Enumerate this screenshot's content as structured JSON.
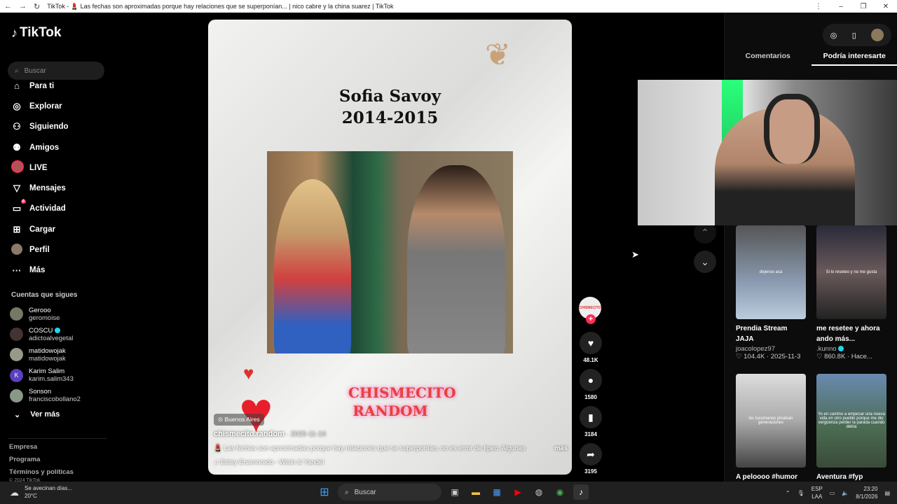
{
  "browser": {
    "title": "TikTok - 💄 Las fechas son aproximadas porque hay relaciones que se superponían... | nico cabre y la china suarez | TikTok"
  },
  "sidebar": {
    "brand": "TikTok",
    "search_placeholder": "Buscar",
    "nav": [
      {
        "label": "Para ti",
        "icon": "home-icon"
      },
      {
        "label": "Explorar",
        "icon": "compass-icon"
      },
      {
        "label": "Siguiendo",
        "icon": "following-icon"
      },
      {
        "label": "Amigos",
        "icon": "friends-icon"
      },
      {
        "label": "LIVE",
        "icon": "live-icon"
      },
      {
        "label": "Mensajes",
        "icon": "messages-icon"
      },
      {
        "label": "Actividad",
        "icon": "activity-icon",
        "badge": "8"
      },
      {
        "label": "Cargar",
        "icon": "upload-icon"
      },
      {
        "label": "Perfil",
        "icon": "profile-icon"
      },
      {
        "label": "Más",
        "icon": "more-icon"
      }
    ],
    "following_title": "Cuentas que sigues",
    "following": [
      {
        "name": "Geroоо",
        "user": "geromoise"
      },
      {
        "name": "COSCU",
        "user": "adictoalvegetal",
        "verified": true
      },
      {
        "name": "matidowojak",
        "user": "matidowojak"
      },
      {
        "name": "Karim Salim",
        "user": "karim.salim343",
        "initial": "K"
      },
      {
        "name": "Sonson",
        "user": "franciscobollano2"
      }
    ],
    "see_more": "Ver más",
    "footer": [
      "Empresa",
      "Programa",
      "Términos y políticas"
    ],
    "copyright": "© 2024 TikTok"
  },
  "video": {
    "title_line1": "Sofia Savoy",
    "title_line2": "2014-2015",
    "brand_line1": "CHISMECITO",
    "brand_line2": "RANDOM",
    "location": "Buenos Aires",
    "author": "chismecito.random",
    "date": " · 2025-11-16",
    "description": "💄 Las fechas son aproximadas porque hay relaciones que se superponían, no es error de tipeo. Algunas",
    "more": "más",
    "music": "Estoy Enamorado - Wisin & Yandel",
    "avatar_text": "CHISMECITO"
  },
  "actions": {
    "likes": "48.1K",
    "comments": "1580",
    "saves": "3184",
    "shares": "3195"
  },
  "right_panel": {
    "tab_comments": "Comentarios",
    "tab_interest": "Podría interesarte",
    "cards": [
      {
        "title": "Prendia Stream JAJA",
        "user": "joacolopez97",
        "likes": "104.4K",
        "date": "2025-11-3",
        "overlay": "dejense aca"
      },
      {
        "title": "me resetee y ahora ando más...",
        "user": ".kunno",
        "likes": "860.8K",
        "date": "Hace...",
        "verified": true,
        "overlay": "Si lo reseteo y no me gusta"
      },
      {
        "title": "A pelоооо #humor",
        "overlay": "los tucumanos pinulean generaciones"
      },
      {
        "title": "Aventura #fyp",
        "overlay": "Yo en camino a empezar una nueva vida en otro pueblo porque me dio vergüenza perder la parada cuando debía"
      }
    ]
  },
  "taskbar": {
    "weather_text": "Se avecinan días...",
    "temperature": "20°C",
    "search": "Buscar",
    "lang1": "ESP",
    "lang2": "LAA",
    "time": "23:20",
    "date": "8/1/2026"
  }
}
